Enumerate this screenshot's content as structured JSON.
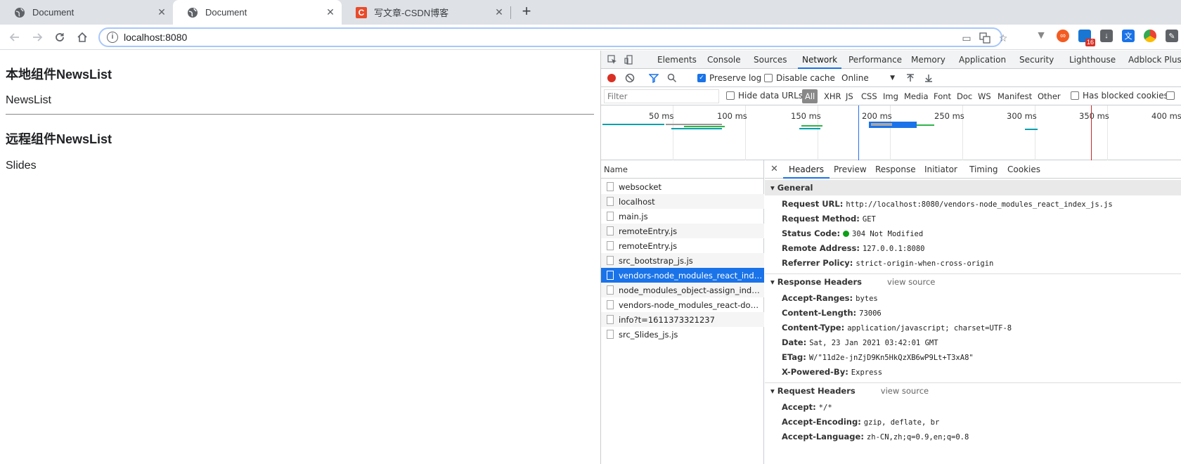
{
  "browser": {
    "tabs": [
      {
        "title": "Document",
        "active": false
      },
      {
        "title": "Document",
        "active": true
      },
      {
        "title": "写文章-CSDN博客",
        "active": false
      }
    ],
    "csdn_logo": "C",
    "url": "localhost:8080",
    "extension_badge": "16"
  },
  "page": {
    "heading1": "本地组件NewsList",
    "text1": "NewsList",
    "heading2": "远程组件NewsList",
    "text2": "Slides"
  },
  "devtools": {
    "tabs": [
      "Elements",
      "Console",
      "Sources",
      "Network",
      "Performance",
      "Memory",
      "Application",
      "Security",
      "Lighthouse",
      "Adblock Plus"
    ],
    "active_tab": "Network",
    "network_toolbar": {
      "preserve_log": "Preserve log",
      "disable_cache": "Disable cache",
      "throttle": "Online"
    },
    "filter": {
      "placeholder": "Filter",
      "hide_data_urls": "Hide data URLs",
      "types": [
        "All",
        "XHR",
        "JS",
        "CSS",
        "Img",
        "Media",
        "Font",
        "Doc",
        "WS",
        "Manifest",
        "Other"
      ],
      "has_blocked_cookies": "Has blocked cookies"
    },
    "overview_ticks": [
      "50 ms",
      "100 ms",
      "150 ms",
      "200 ms",
      "250 ms",
      "300 ms",
      "350 ms",
      "400 ms"
    ],
    "requests_header": "Name",
    "requests": [
      "websocket",
      "localhost",
      "main.js",
      "remoteEntry.js",
      "remoteEntry.js",
      "src_bootstrap_js.js",
      "vendors-node_modules_react_index_js.js",
      "node_modules_object-assign_index_js.js",
      "vendors-node_modules_react-dom_index_js.js",
      "info?t=1611373321237",
      "src_Slides_js.js"
    ],
    "selected_request": 6,
    "detail_tabs": [
      "Headers",
      "Preview",
      "Response",
      "Initiator",
      "Timing",
      "Cookies"
    ],
    "general": {
      "title": "General",
      "request_url_k": "Request URL:",
      "request_url_v": "http://localhost:8080/vendors-node_modules_react_index_js.js",
      "request_method_k": "Request Method:",
      "request_method_v": "GET",
      "status_code_k": "Status Code:",
      "status_code_v": "304 Not Modified",
      "remote_address_k": "Remote Address:",
      "remote_address_v": "127.0.0.1:8080",
      "referrer_policy_k": "Referrer Policy:",
      "referrer_policy_v": "strict-origin-when-cross-origin"
    },
    "response_headers": {
      "title": "Response Headers",
      "view_source": "view source",
      "items": [
        {
          "k": "Accept-Ranges:",
          "v": "bytes"
        },
        {
          "k": "Content-Length:",
          "v": "73006"
        },
        {
          "k": "Content-Type:",
          "v": "application/javascript; charset=UTF-8"
        },
        {
          "k": "Date:",
          "v": "Sat, 23 Jan 2021 03:42:01 GMT"
        },
        {
          "k": "ETag:",
          "v": "W/\"11d2e-jnZjD9Kn5HkQzXB6wP9Lt+T3xA8\""
        },
        {
          "k": "X-Powered-By:",
          "v": "Express"
        }
      ]
    },
    "request_headers": {
      "title": "Request Headers",
      "view_source": "view source",
      "items": [
        {
          "k": "Accept:",
          "v": "*/*"
        },
        {
          "k": "Accept-Encoding:",
          "v": "gzip, deflate, br"
        },
        {
          "k": "Accept-Language:",
          "v": "zh-CN,zh;q=0.9,en;q=0.8"
        }
      ]
    }
  }
}
